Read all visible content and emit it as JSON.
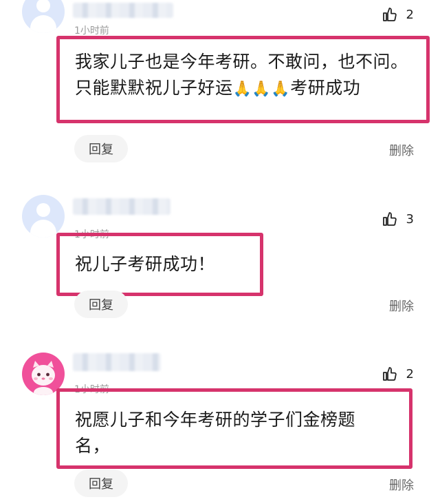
{
  "comments": [
    {
      "time": "1小时前",
      "likes": "2",
      "text_parts": [
        "我家儿子也是今年考研。不敢问，也不问。只能默默祝儿子好运",
        "🙏🙏🙏",
        "考研成功"
      ],
      "reply_label": "回复",
      "delete_label": "删除",
      "avatar_icon": "default-user-icon"
    },
    {
      "time": "1小时前",
      "likes": "3",
      "text": "祝儿子考研成功！",
      "reply_label": "回复",
      "delete_label": "删除",
      "avatar_icon": "default-user-icon"
    },
    {
      "time": "1小时前",
      "likes": "2",
      "text": "祝愿儿子和今年考研的学子们金榜题名，",
      "reply_label": "回复",
      "delete_label": "删除",
      "avatar_icon": "pink-cat-avatar"
    }
  ],
  "colors": {
    "highlight_border": "#d6336c",
    "pink_avatar": "#f0509a"
  }
}
